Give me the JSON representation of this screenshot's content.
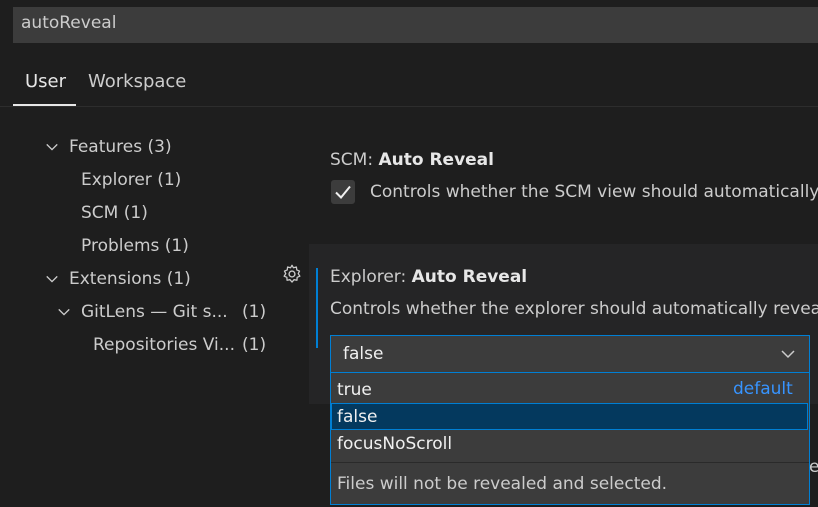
{
  "search": {
    "value": "autoReveal"
  },
  "tabs": [
    {
      "label": "User",
      "active": true
    },
    {
      "label": "Workspace",
      "active": false
    }
  ],
  "tree": {
    "features": {
      "label": "Features",
      "count": "(3)"
    },
    "explorer": {
      "label": "Explorer",
      "count": "(1)"
    },
    "scm": {
      "label": "SCM",
      "count": "(1)"
    },
    "problems": {
      "label": "Problems",
      "count": "(1)"
    },
    "extensions": {
      "label": "Extensions",
      "count": "(1)"
    },
    "gitlens": {
      "label": "GitLens — Git s...",
      "count": "(1)"
    },
    "repositories": {
      "label": "Repositories Vi...",
      "count": "(1)"
    }
  },
  "scm_setting": {
    "category": "SCM: ",
    "name": "Auto Reveal",
    "description": "Controls whether the SCM view should automatically",
    "checked": true
  },
  "explorer_setting": {
    "category": "Explorer: ",
    "name": "Auto Reveal",
    "description": "Controls whether the explorer should automatically revea",
    "selected_value": "false",
    "options": [
      {
        "label": "true",
        "badge": "default"
      },
      {
        "label": "false",
        "selected": true
      },
      {
        "label": "focusNoScroll"
      }
    ],
    "option_description": "Files will not be revealed and selected.",
    "clipped_text": "e"
  },
  "colors": {
    "accent": "#007fd4",
    "link": "#3794ff",
    "background": "#1e1e1e",
    "input": "#3c3c3c"
  }
}
